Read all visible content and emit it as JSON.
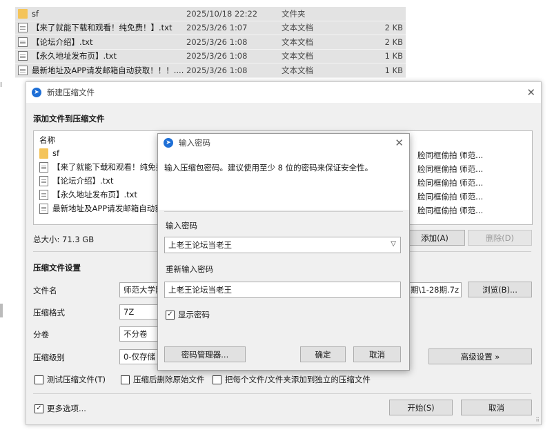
{
  "explorer": {
    "rows": [
      {
        "name": "sf",
        "date": "2025/10/18 22:22",
        "type": "文件夹",
        "size": "",
        "icon": "folder-icon"
      },
      {
        "name": "【来了就能下载和观看！纯免费！】.txt",
        "date": "2025/3/26 1:07",
        "type": "文本文档",
        "size": "2 KB",
        "icon": "text-file-icon"
      },
      {
        "name": "【论坛介绍】.txt",
        "date": "2025/3/26 1:08",
        "type": "文本文档",
        "size": "2 KB",
        "icon": "text-file-icon"
      },
      {
        "name": "【永久地址发布页】.txt",
        "date": "2025/3/26 1:08",
        "type": "文本文档",
        "size": "1 KB",
        "icon": "text-file-icon"
      },
      {
        "name": "最新地址及APP请发邮箱自动获取！！！....",
        "date": "2025/3/26 1:08",
        "type": "文本文档",
        "size": "1 KB",
        "icon": "text-file-icon"
      }
    ]
  },
  "main_dialog": {
    "title": "新建压缩文件",
    "add_files_heading": "添加文件到压缩文件",
    "list_header": "名称",
    "files": [
      {
        "name": "sf",
        "icon": "folder-icon"
      },
      {
        "name": "【来了就能下载和观看！纯免费",
        "icon": "text-file-icon"
      },
      {
        "name": "【论坛介绍】.txt",
        "icon": "text-file-icon"
      },
      {
        "name": "【永久地址发布页】.txt",
        "icon": "text-file-icon"
      },
      {
        "name": "最新地址及APP请发邮箱自动获",
        "icon": "text-file-icon"
      }
    ],
    "right_paths": [
      "脸同框偷拍 师范...",
      "脸同框偷拍 师范...",
      "脸同框偷拍 师范...",
      "脸同框偷拍 师范...",
      "脸同框偷拍 师范..."
    ],
    "total_size": "总大小: 71.3 GB",
    "add_button": "添加(A)",
    "delete_button": "删除(D)",
    "settings_heading": "压缩文件设置",
    "filename_label": "文件名",
    "filename_value": "师范大学附",
    "filename_tail": "期\\1-28期.7z",
    "browse_button": "浏览(B)...",
    "format_label": "压缩格式",
    "format_value": "7Z",
    "split_label": "分卷",
    "split_value": "不分卷",
    "level_label": "压缩级别",
    "level_value": "0-仅存储",
    "advanced_button": "高级设置 »",
    "test_checkbox": "测试压缩文件(T)",
    "delete_after_checkbox": "压缩后删除原始文件",
    "separate_checkbox": "把每个文件/文件夹添加到独立的压缩文件",
    "more_options_checkbox": "更多选项...",
    "start_button": "开始(S)",
    "cancel_button": "取消"
  },
  "password_dialog": {
    "title": "输入密码",
    "message": "输入压缩包密码。建议使用至少 8 位的密码来保证安全性。",
    "enter_label": "输入密码",
    "enter_value": "上老王论坛当老王",
    "reenter_label": "重新输入密码",
    "reenter_value": "上老王论坛当老王",
    "show_password": "显示密码",
    "manager_button": "密码管理器...",
    "ok_button": "确定",
    "cancel_button": "取消"
  }
}
